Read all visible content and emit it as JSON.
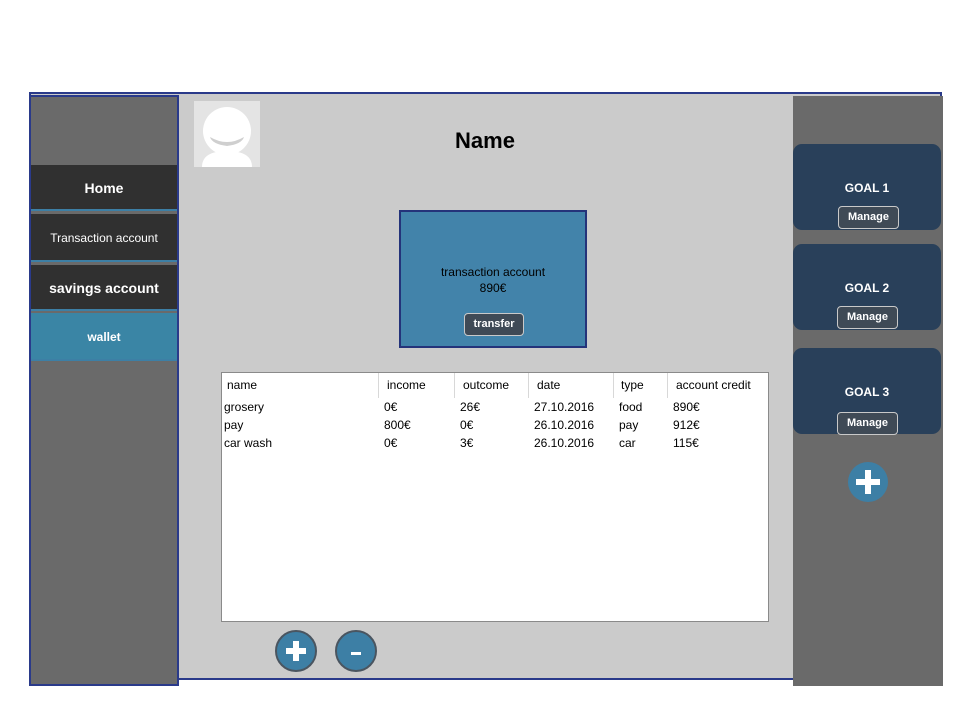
{
  "sidebar": {
    "items": [
      {
        "label": "Home"
      },
      {
        "label": "Transaction account"
      },
      {
        "label": "savings account"
      },
      {
        "label": "wallet"
      }
    ]
  },
  "header": {
    "title": "Name"
  },
  "account_card": {
    "label": "transaction account",
    "value": "890€",
    "button_label": "transfer"
  },
  "table": {
    "columns": [
      "name",
      "income",
      "outcome",
      "date",
      "type",
      "account credit"
    ],
    "rows": [
      [
        "grosery",
        "0€",
        "26€",
        "27.10.2016",
        "food",
        "890€"
      ],
      [
        "pay",
        "800€",
        "0€",
        "26.10.2016",
        "pay",
        "912€"
      ],
      [
        "car wash",
        "0€",
        "3€",
        "26.10.2016",
        "car",
        "115€"
      ]
    ]
  },
  "actions": {
    "add_icon": "plus-icon",
    "remove_icon": "minus-icon"
  },
  "goals": [
    {
      "title": "GOAL 1",
      "button_label": "Manage"
    },
    {
      "title": "GOAL 2",
      "button_label": "Manage"
    },
    {
      "title": "GOAL 3",
      "button_label": "Manage"
    }
  ],
  "colors": {
    "accent": "#3d7fa5",
    "dark_nav": "#303030",
    "goal_card": "#29405a",
    "account_card": "#4283aa",
    "main_bg": "#cbcbcb"
  }
}
